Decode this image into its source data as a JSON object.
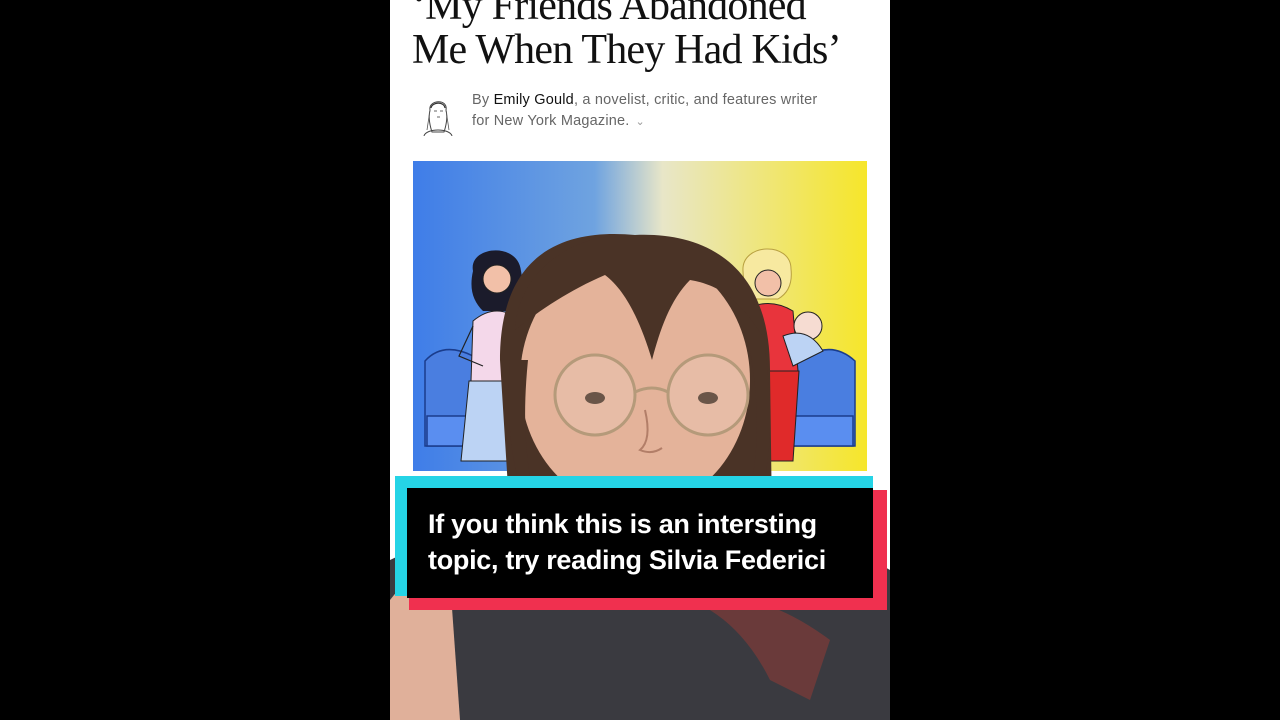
{
  "article": {
    "headline_line1": "‘My Friends Abandoned",
    "headline_line2": "Me When They Had Kids’",
    "byline_prefix": "By ",
    "author": "Emily Gould",
    "author_desc_line1": ", a novelist, critic, and features writer",
    "author_desc_line2": "for New York Magazine.",
    "expand_icon": "chevron-down-icon"
  },
  "caption": {
    "text": "If you think this is an intersting\ntopic, try reading Silvia Federici"
  },
  "colors": {
    "caption_cyan": "#25d4e6",
    "caption_red": "#f0304f",
    "hero_blue": "#3f7de8",
    "hero_yellow": "#f6e62a"
  }
}
